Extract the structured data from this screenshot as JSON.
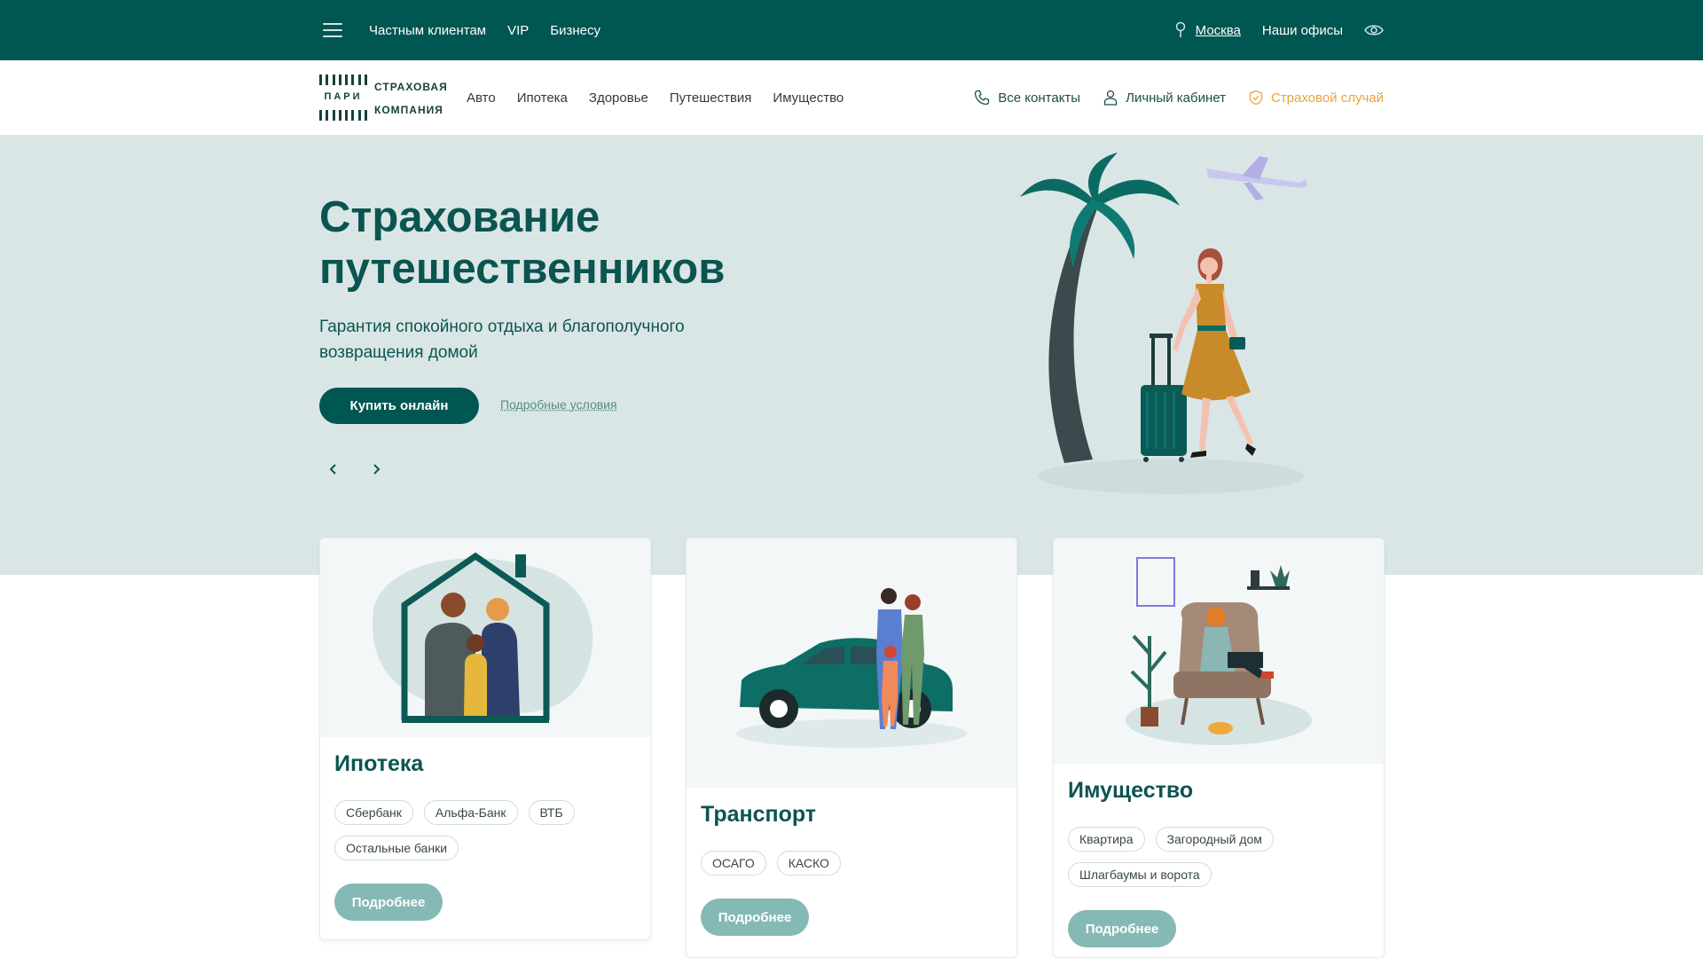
{
  "topbar": {
    "nav": [
      "Частным клиентам",
      "VIP",
      "Бизнесу"
    ],
    "city": "Москва",
    "offices": "Наши офисы"
  },
  "header": {
    "logo": {
      "mark": "ПАРИ",
      "line1": "СТРАХОВАЯ",
      "line2": "КОМПАНИЯ"
    },
    "nav": [
      "Авто",
      "Ипотека",
      "Здоровье",
      "Путешествия",
      "Имущество"
    ],
    "contacts": "Все контакты",
    "cabinet": "Личный кабинет",
    "claim": "Страховой случай"
  },
  "hero": {
    "title_line1": "Страхование",
    "title_line2": "путешественников",
    "subtitle_line1": "Гарантия спокойного отдыха и благополучного",
    "subtitle_line2": "возвращения домой",
    "buy_label": "Купить онлайн",
    "terms_label": "Подробные условия"
  },
  "cards": [
    {
      "title": "Ипотека",
      "tags": [
        "Сбербанк",
        "Альфа-Банк",
        "ВТБ",
        "Остальные банки"
      ],
      "button": "Подробнее"
    },
    {
      "title": "Транспорт",
      "tags": [
        "ОСАГО",
        "КАСКО"
      ],
      "button": "Подробнее"
    },
    {
      "title": "Имущество",
      "tags": [
        "Квартира",
        "Загородный дом",
        "Шлагбаумы и ворота"
      ],
      "button": "Подробнее"
    }
  ],
  "colors": {
    "brand": "#005651",
    "hero_bg": "#dae6e6",
    "accent": "#e8a43a",
    "button_muted": "#85b9b5"
  },
  "icons": [
    "menu-icon",
    "location-pin-icon",
    "eye-icon",
    "phone-icon",
    "user-icon",
    "shield-icon",
    "chevron-left-icon",
    "chevron-right-icon"
  ]
}
